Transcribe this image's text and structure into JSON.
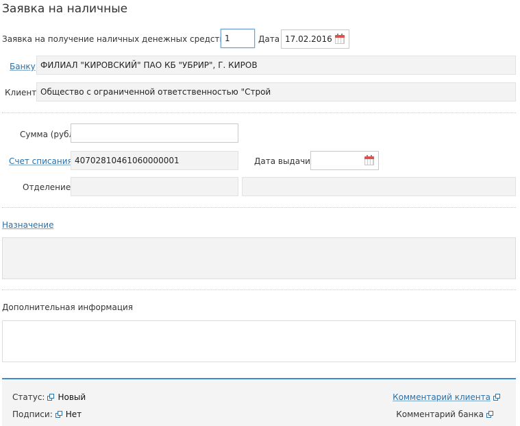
{
  "page": {
    "title": "Заявка на наличные"
  },
  "request": {
    "number_label": "Заявка на получение наличных денежных средств N",
    "number_value": "1",
    "date_label": "Дата",
    "date_value": "17.02.2016"
  },
  "bank": {
    "label": "Банку",
    "value": "ФИЛИАЛ \"КИРОВСКИЙ\" ПАО КБ \"УБРИР\", Г. КИРОВ"
  },
  "client": {
    "label": "Клиент",
    "value": "Общество с ограниченной ответственностью \"Строй"
  },
  "amount": {
    "label": "Сумма (рубли)",
    "value": ""
  },
  "account": {
    "label": "Счет списания",
    "value": "40702810461060000001"
  },
  "issue_date": {
    "label": "Дата выдачи",
    "value": ""
  },
  "department": {
    "label": "Отделение",
    "code": "",
    "name": ""
  },
  "purpose": {
    "label": "Назначение",
    "value": ""
  },
  "additional": {
    "label": "Дополнительная информация",
    "value": ""
  },
  "footer": {
    "status_label": "Статус:",
    "status_value": "Новый",
    "signatures_label": "Подписи:",
    "signatures_value": "Нет",
    "client_comment": "Комментарий клиента",
    "bank_comment": "Комментарий банка"
  },
  "colors": {
    "accent": "#3c8ac6",
    "link": "#2a6fa8",
    "calendar": "#d9534f"
  }
}
